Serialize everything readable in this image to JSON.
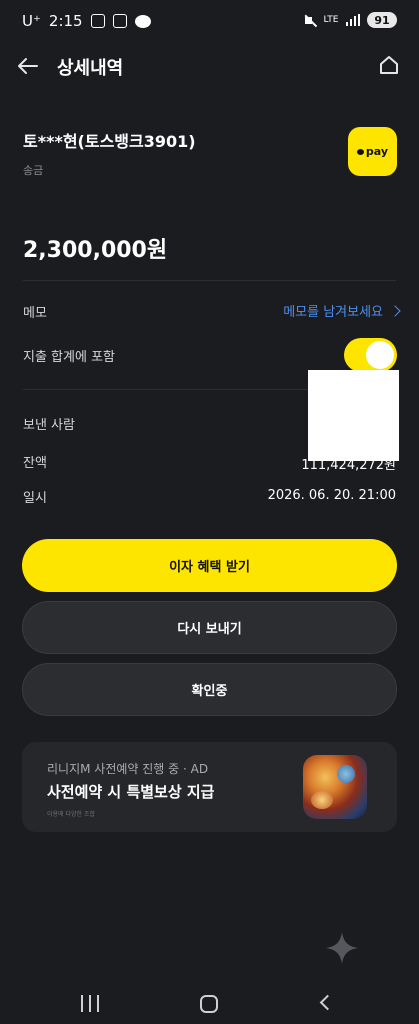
{
  "status_bar": {
    "carrier": "U⁺",
    "time": "2:15",
    "lte": "LTE",
    "battery": "91"
  },
  "header": {
    "title": "상세내역"
  },
  "recipient": {
    "name": "토***현(토스뱅크3901)",
    "type": "송금",
    "logo_text": "pay"
  },
  "amount": "2,300,000원",
  "memo": {
    "label": "메모",
    "link_text": "메모를 남겨보세요"
  },
  "include_total": {
    "label": "지출 합계에 포함",
    "enabled": true
  },
  "details": {
    "sender_label": "보낸 사람",
    "balance_label": "잔액",
    "balance_value": "111,424,272원",
    "datetime_label": "일시",
    "datetime_value": "2026. 06. 20. 21:00"
  },
  "buttons": {
    "interest": "이자 혜택 받기",
    "send_again": "다시 보내기",
    "confirming": "확인중"
  },
  "ad": {
    "subtitle": "리니지M 사전예약 진행 중 · AD",
    "title": "사전예약 시 특별보상 지급",
    "fine_print": "이용에 다양한 조합"
  },
  "colors": {
    "background": "#1b1c1f",
    "accent": "#fee500",
    "link": "#4e8ff0"
  }
}
